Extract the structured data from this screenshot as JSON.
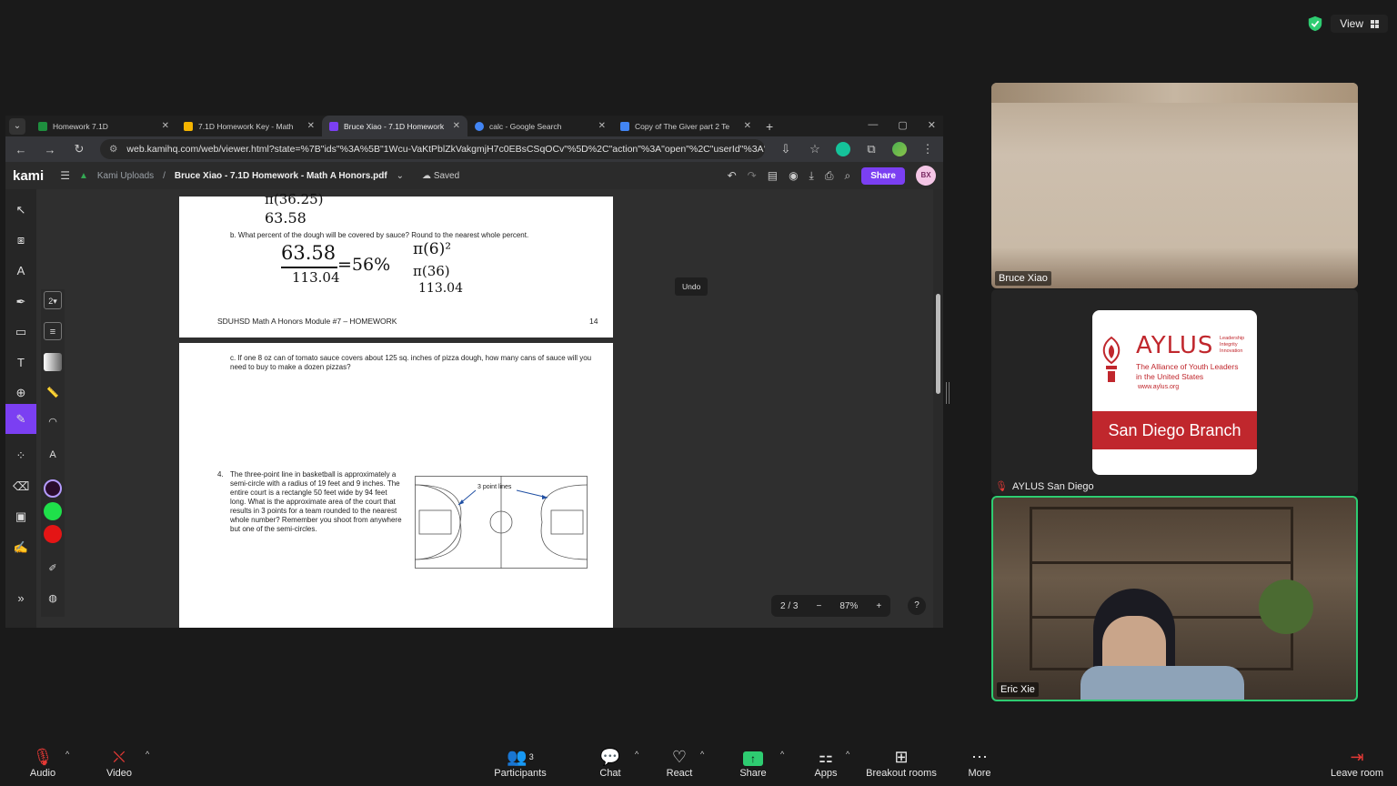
{
  "top_right": {
    "view_label": "View"
  },
  "browser": {
    "tabs": [
      {
        "title": "Homework 7.1D",
        "fav_color": "#1e8e3e"
      },
      {
        "title": "7.1D Homework Key - Math",
        "fav_color": "#f4b400"
      },
      {
        "title": "Bruce Xiao - 7.1D Homework",
        "fav_color": "#7b3ff2"
      },
      {
        "title": "calc - Google Search",
        "fav_color": "#4285f4"
      },
      {
        "title": "Copy of The Giver part 2 Te",
        "fav_color": "#4285f4"
      }
    ],
    "url": "web.kamihq.com/web/viewer.html?state=%7B\"ids\"%3A%5B\"1Wcu-VaKtPblZkVakgmjH7c0EBsCSqOCv\"%5D%2C\"action\"%3A\"open\"%2C\"userId\"%3A\"1..."
  },
  "kami": {
    "logo": "kami",
    "breadcrumb_root": "Kami Uploads",
    "file_name": "Bruce Xiao - 7.1D Homework - Math A Honors.pdf",
    "saved_label": "Saved",
    "share_label": "Share",
    "avatar_initials": "BX",
    "undo_tooltip": "Undo",
    "stroke_size": "2",
    "page_indicator": "2 / 3",
    "zoom": "87%",
    "help": "?"
  },
  "document": {
    "page1": {
      "hw_top": "π(36.25)",
      "hw_top2": "63.58",
      "question_b": "b.   What percent of the dough will be covered by sauce?  Round to the nearest whole percent.",
      "hw_num": "63.58",
      "hw_den": "113.04",
      "hw_result": "=56%",
      "hw_pi1": "π(6)²",
      "hw_pi2": "π(36)",
      "hw_pi3": "113.04",
      "footer_left": "SDUHSD Math A Honors Module #7 – HOMEWORK",
      "footer_right": "14"
    },
    "page2": {
      "question_c": "c.   If one 8 oz can of tomato sauce covers about 125 sq. inches of pizza dough, how many cans of sauce will you need to buy to make a dozen pizzas?",
      "question_4_num": "4.",
      "question_4": "The three-point line in basketball is approximately a semi-circle with a radius of 19 feet and 9 inches. The entire court is a rectangle 50 feet wide by 94 feet long. What is the approximate area of the court that results in 3 points for a team rounded to the nearest whole number? Remember you shoot from anywhere but one of the semi-circles.",
      "court_label": "3 point lines"
    }
  },
  "participants_tiles": [
    {
      "name": "Bruce Xiao"
    },
    {
      "name": "AYLUS San Diego"
    },
    {
      "name": "Eric Xie"
    }
  ],
  "aylus_logo": {
    "title": "AYLUS",
    "tag1": "Leadership",
    "tag2": "Integrity",
    "tag3": "Innovation",
    "line1": "The Alliance of Youth Leaders",
    "line2": "in the United States",
    "url": "www.aylus.org",
    "branch": "San Diego Branch"
  },
  "toolbar": {
    "audio": "Audio",
    "video": "Video",
    "participants": "Participants",
    "participants_count": "3",
    "chat": "Chat",
    "react": "React",
    "share": "Share",
    "apps": "Apps",
    "breakout": "Breakout rooms",
    "more": "More",
    "leave": "Leave room"
  }
}
